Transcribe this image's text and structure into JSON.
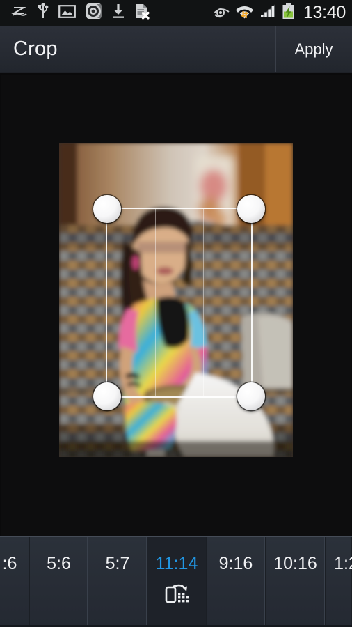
{
  "status_bar": {
    "icons_left": [
      {
        "name": "signature-scribble-icon",
        "label": "S Note"
      },
      {
        "name": "usb-icon",
        "label": "USB connected"
      },
      {
        "name": "image-icon",
        "label": "Screenshot captured"
      },
      {
        "name": "screen-recorder-icon",
        "label": "Screen recorder"
      },
      {
        "name": "download-icon",
        "label": "Download complete"
      },
      {
        "name": "document-error-icon",
        "label": "File error"
      }
    ],
    "icons_right": [
      {
        "name": "smart-stay-eye-icon",
        "label": "Smart stay"
      },
      {
        "name": "wifi-transfer-icon",
        "label": "Wi-Fi connected"
      },
      {
        "name": "cellular-signal-icon",
        "label": "Signal strength"
      },
      {
        "name": "battery-charging-icon",
        "label": "Battery charging"
      }
    ],
    "clock": "13:40",
    "battery_color": "#8bc53f",
    "accent_color": "#2196e3"
  },
  "title_bar": {
    "title": "Crop",
    "apply_label": "Apply"
  },
  "editor": {
    "crop_frame_name": "crop-selection-frame",
    "handles": [
      {
        "name": "crop-handle-top-left"
      },
      {
        "name": "crop-handle-top-right"
      },
      {
        "name": "crop-handle-bottom-left"
      },
      {
        "name": "crop-handle-bottom-right"
      }
    ]
  },
  "ratio_bar": {
    "selected": "11:14",
    "rotate_icon": "rotate-orientation-icon",
    "items": [
      {
        "label": ":6",
        "width": 43,
        "selected": false,
        "clipped": true
      },
      {
        "label": "5:6",
        "width": 84,
        "selected": false,
        "clipped": false
      },
      {
        "label": "5:7",
        "width": 85,
        "selected": false,
        "clipped": false
      },
      {
        "label": "11:14",
        "width": 85,
        "selected": true,
        "clipped": false
      },
      {
        "label": "9:16",
        "width": 85,
        "selected": false,
        "clipped": false
      },
      {
        "label": "10:16",
        "width": 86,
        "selected": false,
        "clipped": false
      },
      {
        "label": "1:2",
        "width": 38,
        "selected": false,
        "clipped": true
      }
    ]
  }
}
